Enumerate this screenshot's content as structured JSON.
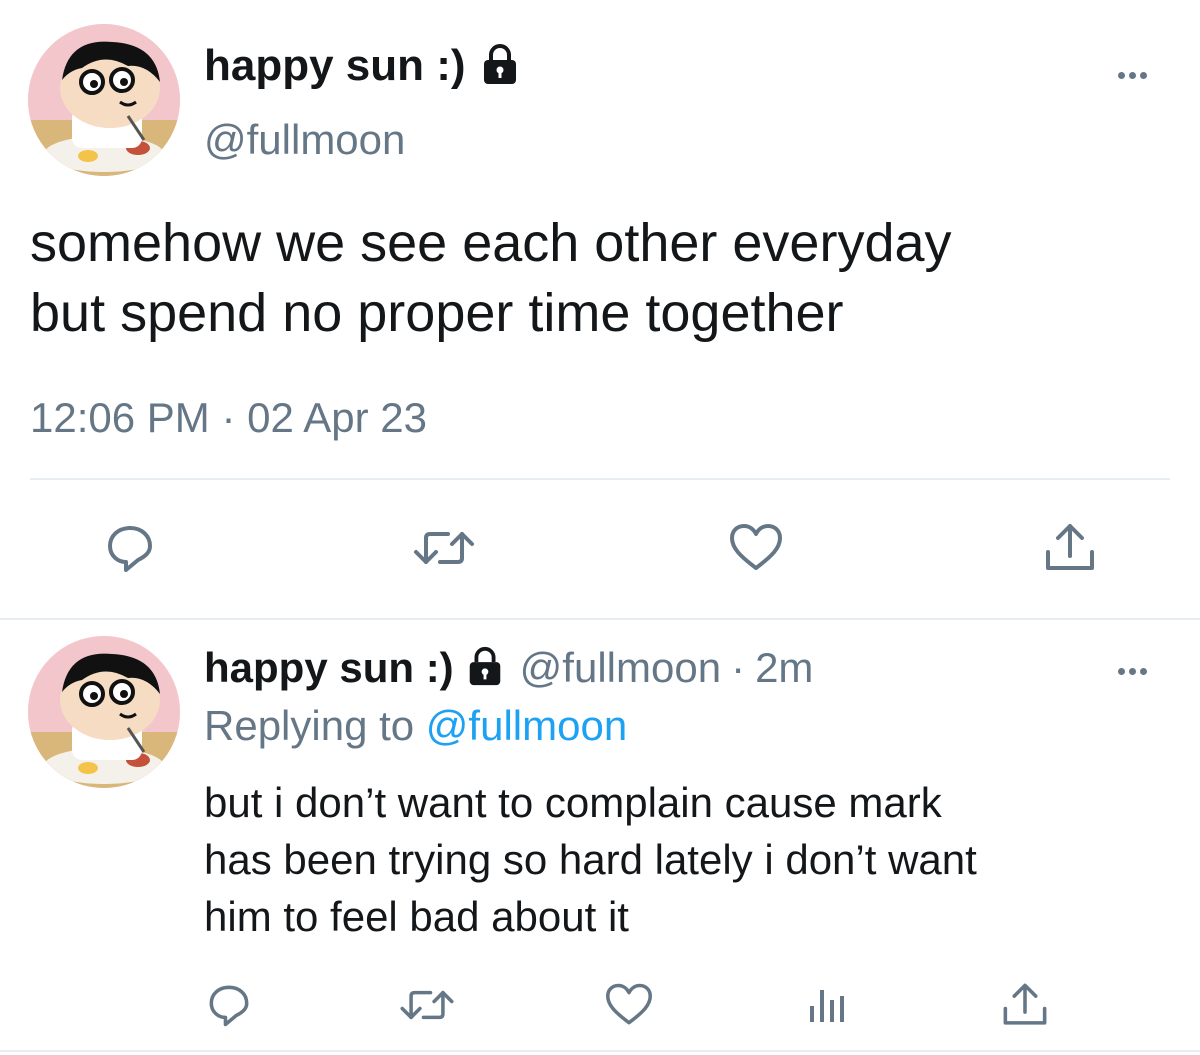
{
  "main_tweet": {
    "display_name": "happy sun :)",
    "handle": "@fullmoon",
    "text_line1": "somehow we see each other everyday",
    "text_line2": "but spend no proper time together",
    "time": "12:06 PM",
    "separator": "·",
    "date": "02 Apr 23",
    "actions": [
      "reply-icon",
      "retweet-icon",
      "like-icon",
      "share-icon"
    ]
  },
  "reply_tweet": {
    "display_name": "happy sun :)",
    "handle": "@fullmoon",
    "separator": "·",
    "age": "2m",
    "replying_label": "Replying to",
    "replying_handle": "@fullmoon",
    "text_line1": "but i don’t want to complain cause mark",
    "text_line2": "has been trying so hard lately i don’t want",
    "text_line3": "him to feel bad about it",
    "actions": [
      "reply-icon",
      "retweet-icon",
      "like-icon",
      "analytics-icon",
      "share-icon"
    ]
  },
  "colors": {
    "text": "#14171a",
    "muted": "#657786",
    "link": "#1da1f2",
    "divider": "#e6ecf0"
  }
}
